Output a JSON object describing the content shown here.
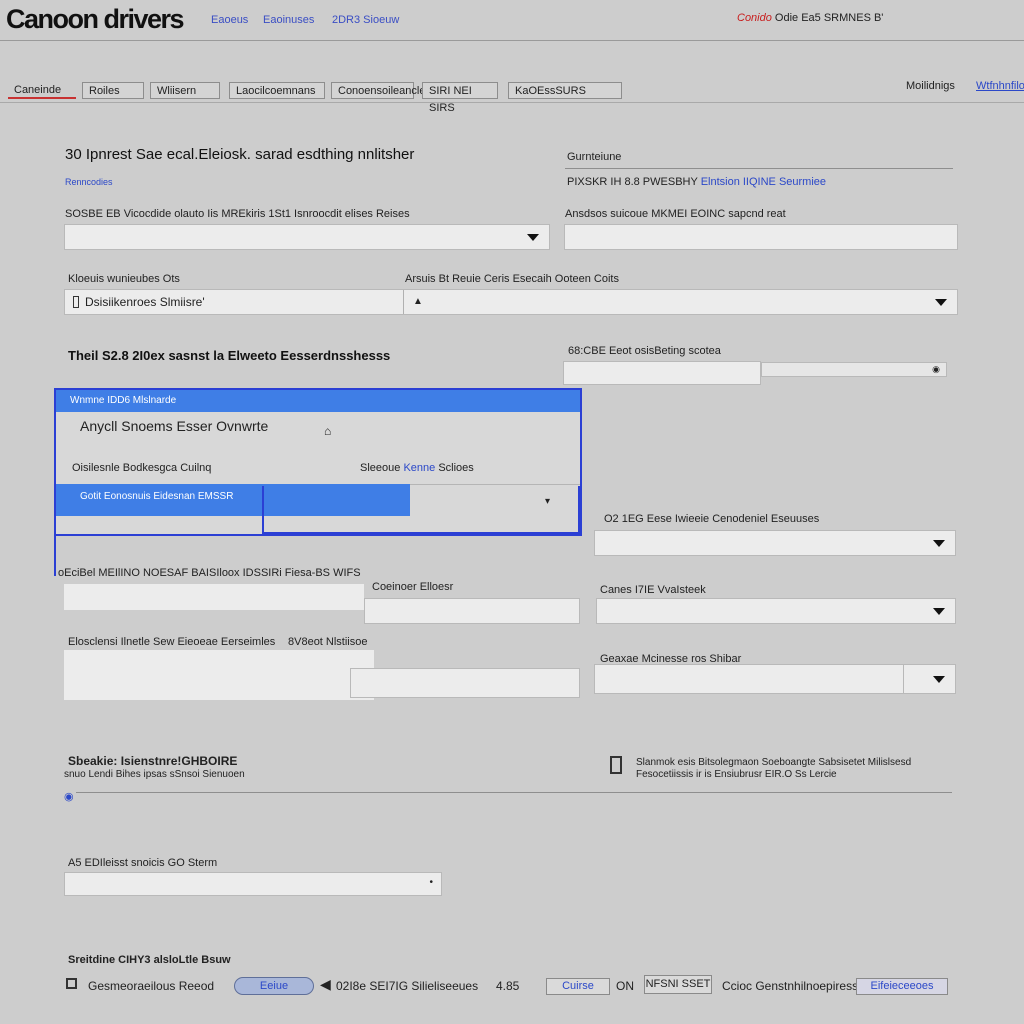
{
  "header": {
    "brand": "Canoon drivers",
    "links": [
      "Eaoeus",
      "Eaoinuses",
      "2DR3 Sioeuw"
    ],
    "right_red": "Conido",
    "right_text": "Odie Ea5 SRMNES B'"
  },
  "tabs": [
    "Caneinde",
    "Roiles",
    "Wliisern",
    "Laocilcoemnans",
    "Conoensoileancle",
    "SIRI NEI SIRS",
    "KaOEssSURS"
  ],
  "tabs_right": {
    "text": "Moilidnigs",
    "link": "Wtfnhnfilor"
  },
  "section1": {
    "title": "30 Ipnrest Sae ecal.Eleiosk. sarad esdthing nnlitsher",
    "link": "Renncodies",
    "right_title": "Gurnteiune",
    "right_sub": "PIXSKR IH 8.8 PWESBHY",
    "right_sub_link": "Elntsion IIQINE Seurmiee",
    "row1_left_label": "SOSBE EB Vicocdide olauto Iis MREkiris 1St1 Isnroocdit elises Reises",
    "row1_right_label": "Ansdsos suicoue MKMEI EOINC sapcnd reat",
    "row2_left_label": "Kloeuis wunieubes Ots",
    "row2_mid_label": "Arsuis Bt Reuie Ceris Esecaih Ooteen Coits",
    "row2_left_value": "Dsisiikenroes Slmiisre'"
  },
  "section2": {
    "title": "Theil S2.8 2I0ex sasnst la Elweeto Eesserdnsshesss",
    "right_label": "68:CBE Eeot osisBeting scotea"
  },
  "dialog": {
    "title": "Wnmne IDD6 Mlslnarde",
    "line1": "Anycll Snoems Esser Ovnwrte",
    "line2_left": "Oisilesnle Bodkesgca Cuilnq",
    "line2_mid": "Sleeoue",
    "line2_link": "Kenne",
    "line2_right": "Sclioes",
    "selected": "Gotit Eonosnuis Eidesnan EMSSR"
  },
  "section3": {
    "right_label": "O2 1EG Eese Iwieeie Cenodeniel Eseuuses",
    "left_label": "oEciBel MEIlINO NOESAF BAISIloox IDSSIRi Fiesa-BS WIFS",
    "mid_label": "Coeinoer Elloesr",
    "right_label2": "Canes I7IE VvaIsteek",
    "left_label2": "Elosclensi Ilnetle Sew Eieoeae Eerseimles",
    "mid_label2": "8V8eot Nlstiisoe",
    "right_label3": "Geaxae Mcinesse ros Shibar"
  },
  "section4": {
    "title": "Sbeakie: Isienstnre!GHBOIRE",
    "sub": "snuo Lendi Bihes ipsas sSnsoi Sienuoen",
    "right_title": "Slanmok esis Bitsolegmaon Soeboangte Sabsisetet Milislsesd",
    "right_sub": "Fesocetiissis ir is Ensiubrusr EIR.O Ss Lercie"
  },
  "section5": {
    "label": "A5 EDIleisst snoicis GO Sterm",
    "footer_title": "Sreitdine CIHY3 alsloLtle Bsuw"
  },
  "footer": {
    "left_text": "Gesmeoraeilous Reeod",
    "pill": "Eeiue",
    "mid_text": "02I8e SEI7IG Silieliseeues",
    "count": "4.85",
    "btn1": "Cuirse",
    "glyph": "ON",
    "btn2": "NFSNI SSET",
    "right_text": "Ccioc Genstnhilnoepiress",
    "right_link": "Eifeieceeoes"
  }
}
